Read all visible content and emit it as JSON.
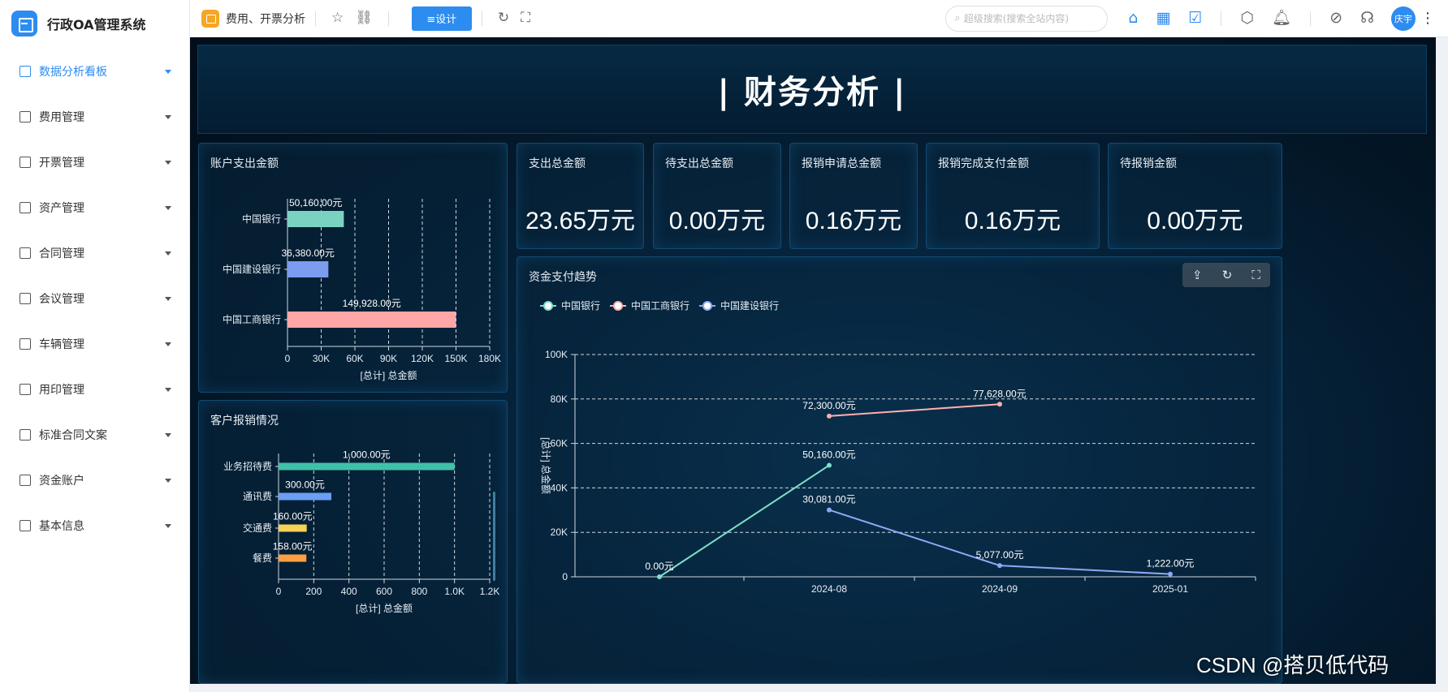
{
  "app": {
    "title": "行政OA管理系统"
  },
  "sidebar": {
    "items": [
      {
        "label": "数据分析看板",
        "icon": "dashboard-icon",
        "active": true
      },
      {
        "label": "费用管理",
        "icon": "document-icon"
      },
      {
        "label": "开票管理",
        "icon": "invoice-icon"
      },
      {
        "label": "资产管理",
        "icon": "user-asset-icon"
      },
      {
        "label": "合同管理",
        "icon": "target-icon"
      },
      {
        "label": "会议管理",
        "icon": "at-icon"
      },
      {
        "label": "车辆管理",
        "icon": "chat-icon"
      },
      {
        "label": "用印管理",
        "icon": "stamp-icon"
      },
      {
        "label": "标准合同文案",
        "icon": "calendar-icon"
      },
      {
        "label": "资金账户",
        "icon": "wallet-icon"
      },
      {
        "label": "基本信息",
        "icon": "info-icon"
      }
    ]
  },
  "topbar": {
    "tab_title": "费用、开票分析",
    "design_button": "≡设计",
    "search_placeholder": "超级搜索(搜索全站内容)",
    "avatar_text": "庆宇"
  },
  "dashboard": {
    "title": "| 财务分析 |",
    "kpis": [
      {
        "label": "支出总金额",
        "value": "23.65万元"
      },
      {
        "label": "待支出总金额",
        "value": "0.00万元"
      },
      {
        "label": "报销申请总金额",
        "value": "0.16万元"
      },
      {
        "label": "报销完成支付金额",
        "value": "0.16万元"
      },
      {
        "label": "待报销金额",
        "value": "0.00万元"
      }
    ]
  },
  "watermark": "CSDN @搭贝低代码",
  "chart_data": [
    {
      "type": "bar",
      "orientation": "horizontal",
      "title": "账户支出金额",
      "categories": [
        "中国银行",
        "中国建设银行",
        "中国工商银行"
      ],
      "values": [
        50160,
        36380,
        149928
      ],
      "value_labels": [
        "50,160.00元",
        "36,380.00元",
        "149,928.00元"
      ],
      "colors": [
        "#7ad3c1",
        "#7c9cf0",
        "#ffa7a7"
      ],
      "xlabel": "[总计] 总金额",
      "xlim": [
        0,
        180000
      ],
      "xticks": [
        "0",
        "30K",
        "60K",
        "90K",
        "120K",
        "150K",
        "180K"
      ],
      "grid": "vertical dashed"
    },
    {
      "type": "bar",
      "orientation": "horizontal",
      "title": "客户报销情况",
      "categories": [
        "业务招待费",
        "通讯费",
        "交通费",
        "餐费"
      ],
      "values": [
        1000,
        300,
        160,
        158
      ],
      "value_labels": [
        "1,000.00元",
        "300.00元",
        "160.00元",
        "158.00元"
      ],
      "colors": [
        "#3fc1a8",
        "#6b9ef5",
        "#f7d154",
        "#ff9f43"
      ],
      "xlabel": "[总计] 总金额",
      "xlim": [
        0,
        1200
      ],
      "xticks": [
        "0",
        "200",
        "400",
        "600",
        "800",
        "1.0K",
        "1.2K"
      ],
      "grid": "vertical dashed"
    },
    {
      "type": "line",
      "title": "资金支付趋势",
      "ylabel": "[总计] 总金额",
      "ylim": [
        0,
        100000
      ],
      "yticks": [
        "0",
        "20K",
        "40K",
        "60K",
        "80K",
        "100K"
      ],
      "x_categories": [
        "",
        "2024-08",
        "2024-09",
        "2025-01"
      ],
      "legend_position": "top-left",
      "series": [
        {
          "name": "中国银行",
          "color": "#7ee0cc",
          "points": [
            [
              0,
              0
            ],
            [
              1,
              50160
            ]
          ],
          "labels": [
            "0.00元",
            "50,160.00元"
          ]
        },
        {
          "name": "中国工商银行",
          "color": "#ffb0b0",
          "points": [
            [
              1,
              72300
            ],
            [
              2,
              77628
            ]
          ],
          "labels": [
            "72,300.00元",
            "77,628.00元"
          ]
        },
        {
          "name": "中国建设银行",
          "color": "#8fa8f5",
          "points": [
            [
              1,
              30081
            ],
            [
              2,
              5077
            ],
            [
              3,
              1222
            ]
          ],
          "labels": [
            "30,081.00元",
            "5,077.00元",
            "1,222.00元"
          ]
        }
      ]
    }
  ]
}
